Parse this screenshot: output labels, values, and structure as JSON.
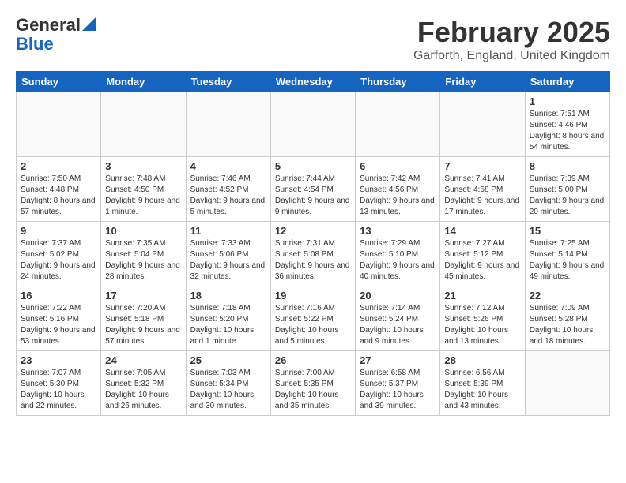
{
  "header": {
    "logo_line1": "General",
    "logo_line2": "Blue",
    "title": "February 2025",
    "subtitle": "Garforth, England, United Kingdom"
  },
  "days_of_week": [
    "Sunday",
    "Monday",
    "Tuesday",
    "Wednesday",
    "Thursday",
    "Friday",
    "Saturday"
  ],
  "weeks": [
    [
      {
        "day": "",
        "info": ""
      },
      {
        "day": "",
        "info": ""
      },
      {
        "day": "",
        "info": ""
      },
      {
        "day": "",
        "info": ""
      },
      {
        "day": "",
        "info": ""
      },
      {
        "day": "",
        "info": ""
      },
      {
        "day": "1",
        "info": "Sunrise: 7:51 AM\nSunset: 4:46 PM\nDaylight: 8 hours and 54 minutes."
      }
    ],
    [
      {
        "day": "2",
        "info": "Sunrise: 7:50 AM\nSunset: 4:48 PM\nDaylight: 8 hours and 57 minutes."
      },
      {
        "day": "3",
        "info": "Sunrise: 7:48 AM\nSunset: 4:50 PM\nDaylight: 9 hours and 1 minute."
      },
      {
        "day": "4",
        "info": "Sunrise: 7:46 AM\nSunset: 4:52 PM\nDaylight: 9 hours and 5 minutes."
      },
      {
        "day": "5",
        "info": "Sunrise: 7:44 AM\nSunset: 4:54 PM\nDaylight: 9 hours and 9 minutes."
      },
      {
        "day": "6",
        "info": "Sunrise: 7:42 AM\nSunset: 4:56 PM\nDaylight: 9 hours and 13 minutes."
      },
      {
        "day": "7",
        "info": "Sunrise: 7:41 AM\nSunset: 4:58 PM\nDaylight: 9 hours and 17 minutes."
      },
      {
        "day": "8",
        "info": "Sunrise: 7:39 AM\nSunset: 5:00 PM\nDaylight: 9 hours and 20 minutes."
      }
    ],
    [
      {
        "day": "9",
        "info": "Sunrise: 7:37 AM\nSunset: 5:02 PM\nDaylight: 9 hours and 24 minutes."
      },
      {
        "day": "10",
        "info": "Sunrise: 7:35 AM\nSunset: 5:04 PM\nDaylight: 9 hours and 28 minutes."
      },
      {
        "day": "11",
        "info": "Sunrise: 7:33 AM\nSunset: 5:06 PM\nDaylight: 9 hours and 32 minutes."
      },
      {
        "day": "12",
        "info": "Sunrise: 7:31 AM\nSunset: 5:08 PM\nDaylight: 9 hours and 36 minutes."
      },
      {
        "day": "13",
        "info": "Sunrise: 7:29 AM\nSunset: 5:10 PM\nDaylight: 9 hours and 40 minutes."
      },
      {
        "day": "14",
        "info": "Sunrise: 7:27 AM\nSunset: 5:12 PM\nDaylight: 9 hours and 45 minutes."
      },
      {
        "day": "15",
        "info": "Sunrise: 7:25 AM\nSunset: 5:14 PM\nDaylight: 9 hours and 49 minutes."
      }
    ],
    [
      {
        "day": "16",
        "info": "Sunrise: 7:22 AM\nSunset: 5:16 PM\nDaylight: 9 hours and 53 minutes."
      },
      {
        "day": "17",
        "info": "Sunrise: 7:20 AM\nSunset: 5:18 PM\nDaylight: 9 hours and 57 minutes."
      },
      {
        "day": "18",
        "info": "Sunrise: 7:18 AM\nSunset: 5:20 PM\nDaylight: 10 hours and 1 minute."
      },
      {
        "day": "19",
        "info": "Sunrise: 7:16 AM\nSunset: 5:22 PM\nDaylight: 10 hours and 5 minutes."
      },
      {
        "day": "20",
        "info": "Sunrise: 7:14 AM\nSunset: 5:24 PM\nDaylight: 10 hours and 9 minutes."
      },
      {
        "day": "21",
        "info": "Sunrise: 7:12 AM\nSunset: 5:26 PM\nDaylight: 10 hours and 13 minutes."
      },
      {
        "day": "22",
        "info": "Sunrise: 7:09 AM\nSunset: 5:28 PM\nDaylight: 10 hours and 18 minutes."
      }
    ],
    [
      {
        "day": "23",
        "info": "Sunrise: 7:07 AM\nSunset: 5:30 PM\nDaylight: 10 hours and 22 minutes."
      },
      {
        "day": "24",
        "info": "Sunrise: 7:05 AM\nSunset: 5:32 PM\nDaylight: 10 hours and 26 minutes."
      },
      {
        "day": "25",
        "info": "Sunrise: 7:03 AM\nSunset: 5:34 PM\nDaylight: 10 hours and 30 minutes."
      },
      {
        "day": "26",
        "info": "Sunrise: 7:00 AM\nSunset: 5:35 PM\nDaylight: 10 hours and 35 minutes."
      },
      {
        "day": "27",
        "info": "Sunrise: 6:58 AM\nSunset: 5:37 PM\nDaylight: 10 hours and 39 minutes."
      },
      {
        "day": "28",
        "info": "Sunrise: 6:56 AM\nSunset: 5:39 PM\nDaylight: 10 hours and 43 minutes."
      },
      {
        "day": "",
        "info": ""
      }
    ]
  ]
}
